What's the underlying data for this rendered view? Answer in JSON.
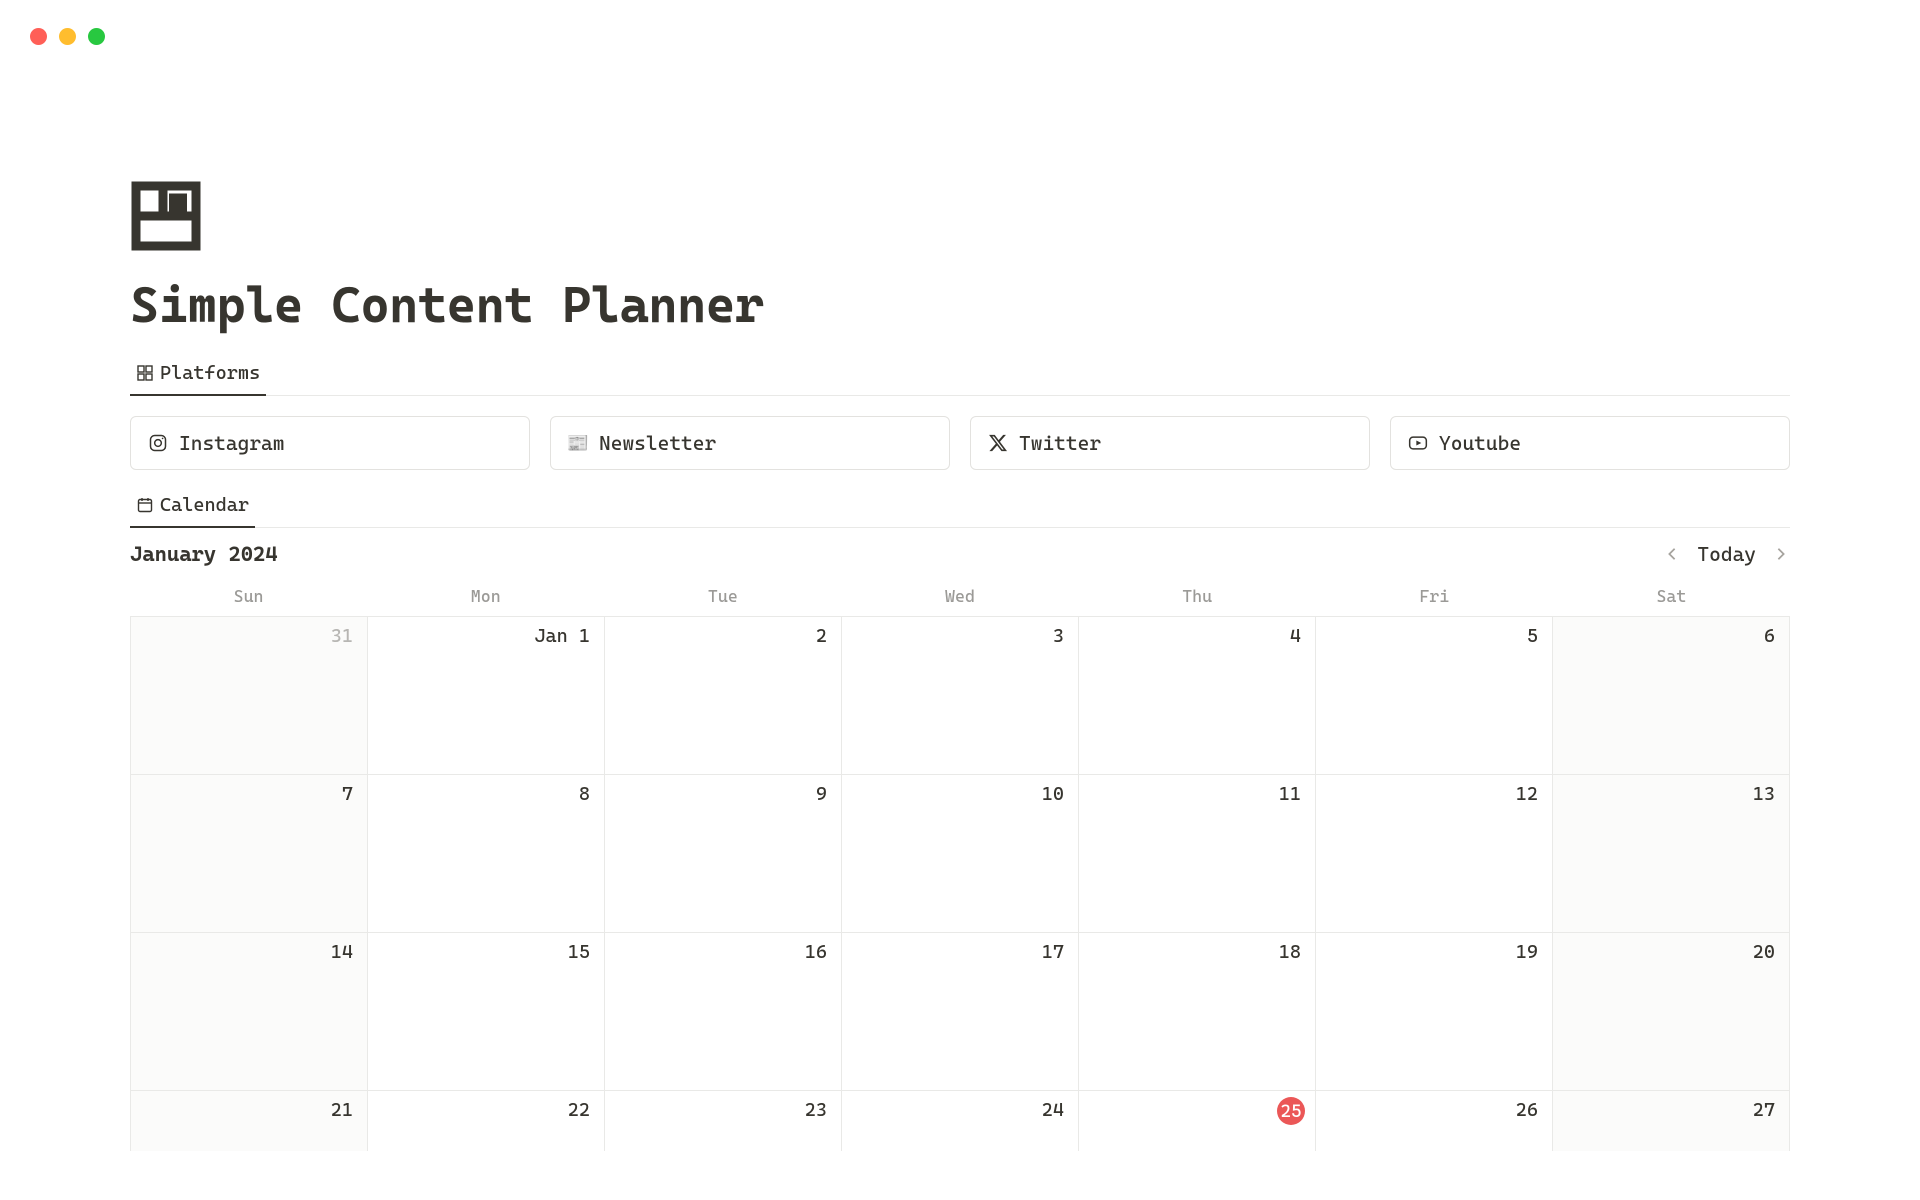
{
  "page": {
    "title": "Simple Content Planner"
  },
  "tabs": {
    "platforms": "Platforms",
    "calendar": "Calendar"
  },
  "platforms": [
    {
      "label": "Instagram",
      "icon": "instagram"
    },
    {
      "label": "Newsletter",
      "icon": "newspaper"
    },
    {
      "label": "Twitter",
      "icon": "x"
    },
    {
      "label": "Youtube",
      "icon": "youtube"
    }
  ],
  "calendar": {
    "month_label": "January 2024",
    "today_label": "Today",
    "today_day": 25,
    "dows": [
      "Sun",
      "Mon",
      "Tue",
      "Wed",
      "Thu",
      "Fri",
      "Sat"
    ],
    "weeks": [
      [
        {
          "label": "31",
          "other": true,
          "shade": true
        },
        {
          "label": "Jan 1"
        },
        {
          "label": "2"
        },
        {
          "label": "3"
        },
        {
          "label": "4"
        },
        {
          "label": "5"
        },
        {
          "label": "6",
          "shade": true
        }
      ],
      [
        {
          "label": "7",
          "shade": true
        },
        {
          "label": "8"
        },
        {
          "label": "9"
        },
        {
          "label": "10"
        },
        {
          "label": "11"
        },
        {
          "label": "12"
        },
        {
          "label": "13",
          "shade": true
        }
      ],
      [
        {
          "label": "14",
          "shade": true
        },
        {
          "label": "15"
        },
        {
          "label": "16"
        },
        {
          "label": "17"
        },
        {
          "label": "18"
        },
        {
          "label": "19"
        },
        {
          "label": "20",
          "shade": true
        }
      ],
      [
        {
          "label": "21",
          "shade": true
        },
        {
          "label": "22"
        },
        {
          "label": "23"
        },
        {
          "label": "24"
        },
        {
          "label": "25",
          "today": true
        },
        {
          "label": "26"
        },
        {
          "label": "27",
          "shade": true
        }
      ]
    ]
  }
}
